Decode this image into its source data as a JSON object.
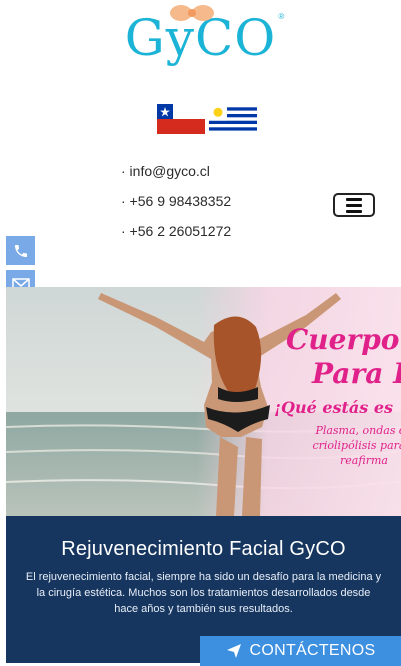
{
  "brand": {
    "logo_text": "GyCO",
    "reg_mark": "®",
    "color": "#1bb3d6",
    "bow_color": "#f6b98b"
  },
  "flags": [
    {
      "name": "chile-flag"
    },
    {
      "name": "uruguay-flag"
    }
  ],
  "contacts": [
    {
      "text": "· info@gyco.cl"
    },
    {
      "text": "· +56 9 98438352"
    },
    {
      "text": "· +56 2 26051272"
    }
  ],
  "side_tabs": [
    {
      "icon": "phone-icon"
    },
    {
      "icon": "mail-icon"
    }
  ],
  "hero": {
    "promo_line1": "Cuerpo J",
    "promo_line2": "Para D",
    "promo_sub": "¡Qué estás es",
    "promo_body": [
      "Plasma, ondas de",
      "criolipólisis para a",
      "reafirma"
    ],
    "accent": "#e0218a"
  },
  "panel": {
    "title": "Rejuvenecimiento Facial GyCO",
    "description": "El rejuvenecimiento facial, siempre ha sido un desafío para la medicina y la cirugía estética. Muchos son los tratamientos desarrollados desde hace años y también sus resultados.",
    "cta_label": "CONTÁCTENOS",
    "cta_icon": "send-icon",
    "background": "#16365f",
    "cta_color": "#3d8fe0"
  }
}
